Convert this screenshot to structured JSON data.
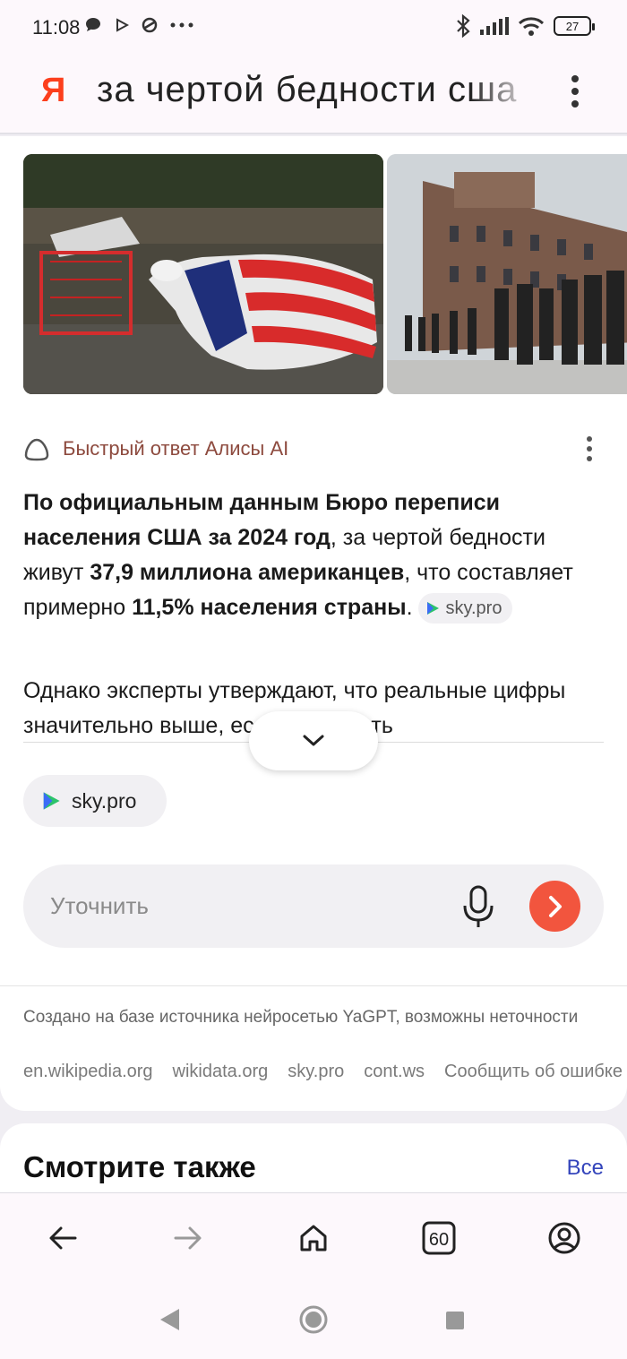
{
  "status_bar": {
    "time": "11:08",
    "battery": "27"
  },
  "search": {
    "logo": "Я",
    "query": "за чертой бедности сша"
  },
  "alice": {
    "label": "Быстрый ответ Алисы AI"
  },
  "answer": {
    "p1_bold": "По официальным данным Бюро переписи населения США за 2024 год",
    "p1_a": ", за чертой бедности живут ",
    "p1_bold2": "37,9 миллиона американцев",
    "p1_b": ", что составляет примерно ",
    "p1_bold3": "11,5% населения страны",
    "p1_c": ".",
    "inline_source": "sky.pro",
    "p2": "Однако эксперты утверждают, что реальные цифры значительно выше, если учитывать"
  },
  "source_chip": "sky.pro",
  "refine": {
    "placeholder": "Уточнить"
  },
  "disclaimer": "Создано на базе источника нейросетью YaGPT, возможны неточности",
  "sources": [
    "en.wikipedia.org",
    "wikidata.org",
    "sky.pro",
    "cont.ws",
    "Сообщить об ошибке"
  ],
  "see_also": {
    "title": "Смотрите также",
    "all": "Все"
  },
  "bottom_nav": {
    "tabs_count": "60"
  },
  "colors": {
    "yandex_red": "#fc3f1d",
    "send_button": "#f2553e",
    "link_blue": "#3344bb"
  }
}
